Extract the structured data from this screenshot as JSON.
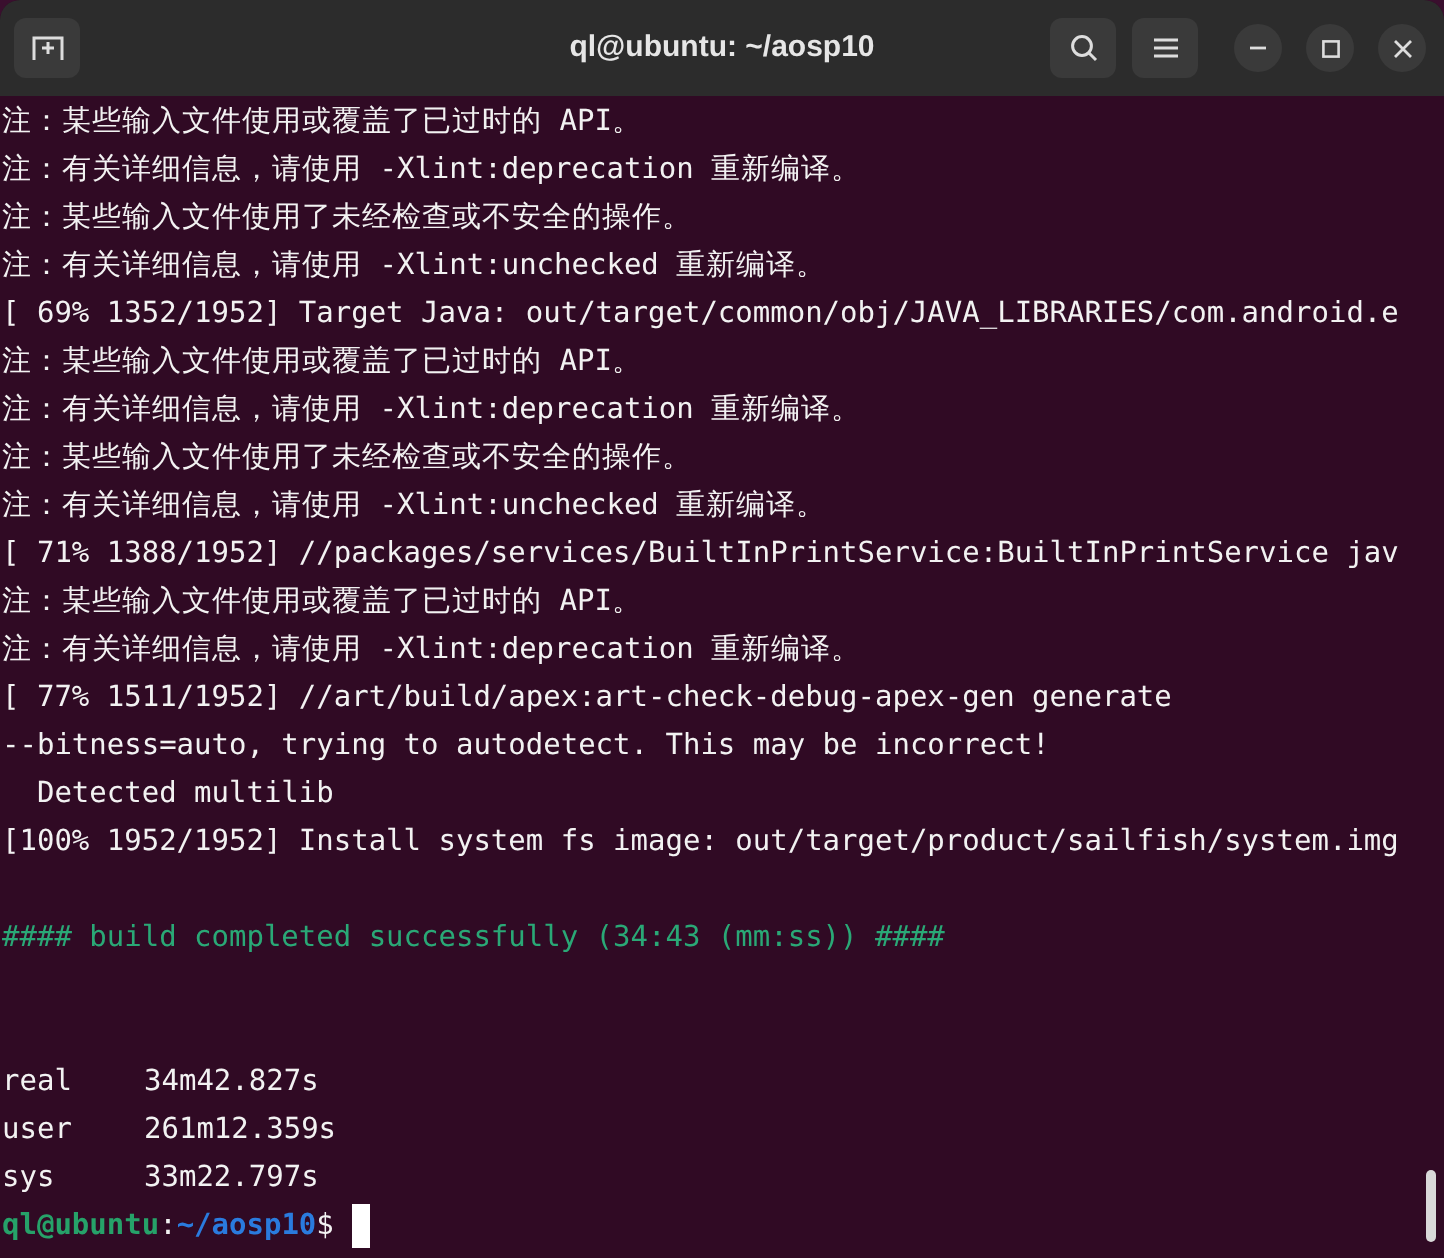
{
  "window": {
    "title": "ql@ubuntu: ~/aosp10"
  },
  "lines": [
    {
      "kind": "text",
      "text": "注：某些输入文件使用或覆盖了已过时的 API。"
    },
    {
      "kind": "text",
      "text": "注：有关详细信息，请使用 -Xlint:deprecation 重新编译。"
    },
    {
      "kind": "text",
      "text": "注：某些输入文件使用了未经检查或不安全的操作。"
    },
    {
      "kind": "text",
      "text": "注：有关详细信息，请使用 -Xlint:unchecked 重新编译。"
    },
    {
      "kind": "text",
      "text": "[ 69% 1352/1952] Target Java: out/target/common/obj/JAVA_LIBRARIES/com.android.e"
    },
    {
      "kind": "text",
      "text": "注：某些输入文件使用或覆盖了已过时的 API。"
    },
    {
      "kind": "text",
      "text": "注：有关详细信息，请使用 -Xlint:deprecation 重新编译。"
    },
    {
      "kind": "text",
      "text": "注：某些输入文件使用了未经检查或不安全的操作。"
    },
    {
      "kind": "text",
      "text": "注：有关详细信息，请使用 -Xlint:unchecked 重新编译。"
    },
    {
      "kind": "text",
      "text": "[ 71% 1388/1952] //packages/services/BuiltInPrintService:BuiltInPrintService jav"
    },
    {
      "kind": "text",
      "text": "注：某些输入文件使用或覆盖了已过时的 API。"
    },
    {
      "kind": "text",
      "text": "注：有关详细信息，请使用 -Xlint:deprecation 重新编译。"
    },
    {
      "kind": "text",
      "text": "[ 77% 1511/1952] //art/build/apex:art-check-debug-apex-gen generate"
    },
    {
      "kind": "text",
      "text": "--bitness=auto, trying to autodetect. This may be incorrect!"
    },
    {
      "kind": "text",
      "text": "  Detected multilib"
    },
    {
      "kind": "text",
      "text": "[100% 1952/1952] Install system fs image: out/target/product/sailfish/system.img"
    },
    {
      "kind": "blank"
    },
    {
      "kind": "success",
      "text": "#### build completed successfully (34:43 (mm:ss)) ####"
    },
    {
      "kind": "blank"
    },
    {
      "kind": "blank"
    },
    {
      "kind": "timing",
      "label": "real",
      "value": "34m42.827s"
    },
    {
      "kind": "timing",
      "label": "user",
      "value": "261m12.359s"
    },
    {
      "kind": "timing",
      "label": "sys",
      "value": "33m22.797s"
    },
    {
      "kind": "prompt",
      "user": "ql@ubuntu",
      "sep": ":",
      "path": "~/aosp10",
      "symbol": "$"
    }
  ]
}
